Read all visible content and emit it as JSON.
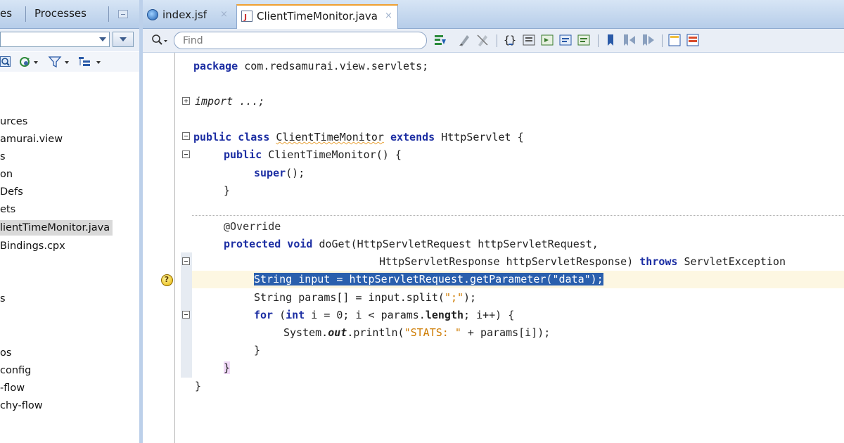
{
  "left_panel": {
    "tabs": [
      "es",
      "Processes"
    ],
    "tree": [
      "urces",
      "amurai.view",
      "s",
      "on",
      "Defs",
      "ets",
      "lientTimeMonitor.java",
      "Bindings.cpx",
      "s",
      "os",
      "config",
      "-flow",
      "chy-flow"
    ],
    "tree_selected": "lientTimeMonitor.java"
  },
  "editor": {
    "tabs": [
      {
        "label": "index.jsf",
        "icon": "globe-icon",
        "active": false,
        "close": "×"
      },
      {
        "label": "ClientTimeMonitor.java",
        "icon": "java-file-icon",
        "active": true,
        "close": "×"
      }
    ],
    "find_placeholder": "Find",
    "code": {
      "l1_kw": "package",
      "l1_rest": " com.redsamurai.view.servlets;",
      "l2_kw": "import",
      "l2_rest": " ...;",
      "l3_kw1": "public class",
      "l3_name": "ClientTimeMonitor",
      "l3_kw2": "extends",
      "l3_rest": " HttpServlet {",
      "l4_kw": "public",
      "l4_rest": " ClientTimeMonitor() {",
      "l5_kw": "super",
      "l5_rest": "();",
      "l6": "}",
      "l7": "@Override",
      "l8_kw": "protected void",
      "l8_rest": " doGet(HttpServletRequest httpServletRequest,",
      "l9_a": "HttpServletResponse httpServletResponse) ",
      "l9_kw": "throws",
      "l9_b": " ServletException",
      "l10": "String input = httpServletRequest.getParameter(\"data\");",
      "l11_a": "String params[] = input.split(",
      "l11_str": "\";\"",
      "l11_b": ");",
      "l12_kw1": "for",
      "l12_a": " (",
      "l12_kw2": "int",
      "l12_b": " i = 0; i < params.",
      "l12_kw3": "length",
      "l12_c": "; i++) {",
      "l13_a": "System.",
      "l13_it": "out",
      "l13_b": ".println(",
      "l13_str": "\"STATS: \"",
      "l13_c": " + params[i]);",
      "l14": "}",
      "l15": "}",
      "l16": "}"
    }
  }
}
